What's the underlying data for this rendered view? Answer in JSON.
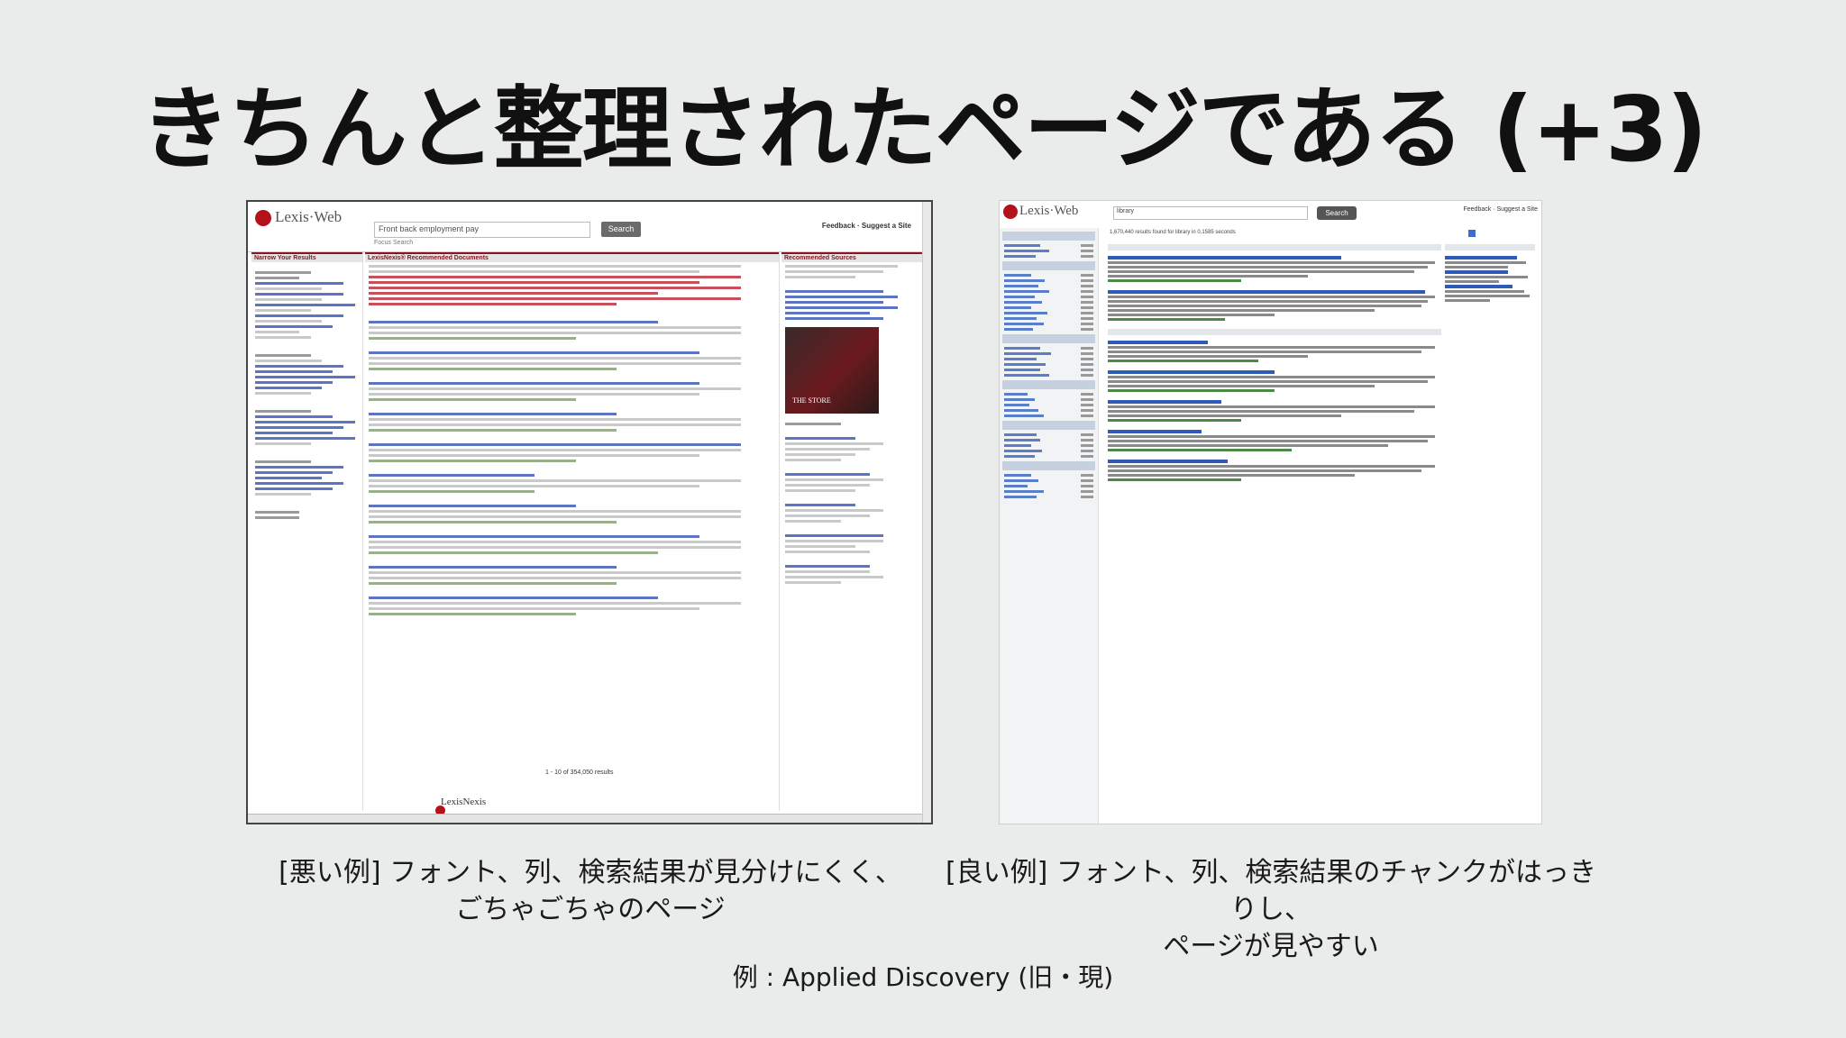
{
  "slide": {
    "title": "きちんと整理されたページである (+3)",
    "bad_caption_line1": "[悪い例] フォント、列、検索結果が見分けにくく、",
    "bad_caption_line2": "ごちゃごちゃのページ",
    "good_caption_line1": "[良い例] フォント、列、検索結果のチャンクがはっきりし、",
    "good_caption_line2": "ページが見やすい",
    "example_note": "例 : Applied Discovery (旧・現)"
  },
  "bad_screenshot": {
    "logo": "Lexis·Web",
    "search_value": "Front back employment pay",
    "focus_search": "Focus Search",
    "search_button": "Search",
    "feedback": "Feedback · Suggest a Site",
    "left_heading": "Narrow Your Results",
    "mid_heading": "LexisNexis® Recommended Documents",
    "right_heading": "Recommended Sources",
    "ad_text": "THE STORE",
    "pager": "1 - 10 of 354,050 results",
    "footer_logo": "LexisNexis"
  },
  "good_screenshot": {
    "logo": "Lexis·Web",
    "search_value": "library",
    "search_button": "Search",
    "feedback": "Feedback · Suggest a Site",
    "results_count": "1,670,440 results found for library in 0.1585 seconds"
  },
  "colors": {
    "lexis_red": "#b3121a",
    "link_blue": "#2f5bb8",
    "url_green": "#4e8a47",
    "background": "#eaeceb"
  }
}
